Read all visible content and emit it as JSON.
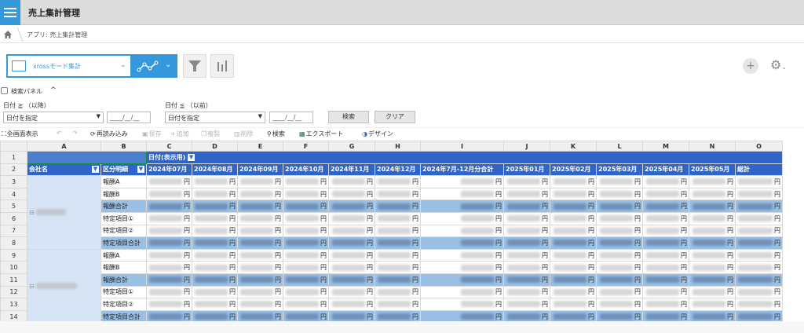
{
  "header": {
    "title": "売上集計管理"
  },
  "breadcrumb": {
    "path": "アプリ: 売上集計管理"
  },
  "toolbar": {
    "view_label": "xrossモード集計"
  },
  "search_panel": {
    "title": "検索パネル",
    "from_label": "日付 ≧ （以降）",
    "to_label": "日付 ≦ （以前）",
    "from_select": "日付を指定",
    "to_select": "日付を指定",
    "date_placeholder": "____/__/__",
    "search_button": "検索",
    "clear_button": "クリア"
  },
  "actions": {
    "fullscreen": "全画面表示",
    "reload": "再読み込み",
    "save": "保存",
    "add": "追加",
    "copy": "複製",
    "delete": "削除",
    "search": "検索",
    "export": "エクスポート",
    "design": "デザイン"
  },
  "grid": {
    "column_letters": [
      "A",
      "B",
      "C",
      "D",
      "E",
      "F",
      "G",
      "H",
      "I",
      "J",
      "K",
      "L",
      "M",
      "N",
      "O"
    ],
    "row_numbers": [
      "1",
      "2",
      "3",
      "4",
      "5",
      "6",
      "7",
      "8",
      "9",
      "10",
      "11",
      "12",
      "13",
      "14"
    ],
    "field_header": "日付(表示用)",
    "company_header": "会社名",
    "category_header": "区分明細",
    "date_headers": [
      "2024年07月",
      "2024年08月",
      "2024年09月",
      "2024年10月",
      "2024年11月",
      "2024年12月",
      "2024年7月-12月分合計",
      "2025年01月",
      "2025年02月",
      "2025年03月",
      "2025年04月",
      "2025年05月",
      "総計"
    ],
    "categories": [
      "報酬A",
      "報酬B",
      "報酬合計",
      "特定項目①",
      "特定項目②",
      "特定項目合計"
    ],
    "unit": "円"
  }
}
